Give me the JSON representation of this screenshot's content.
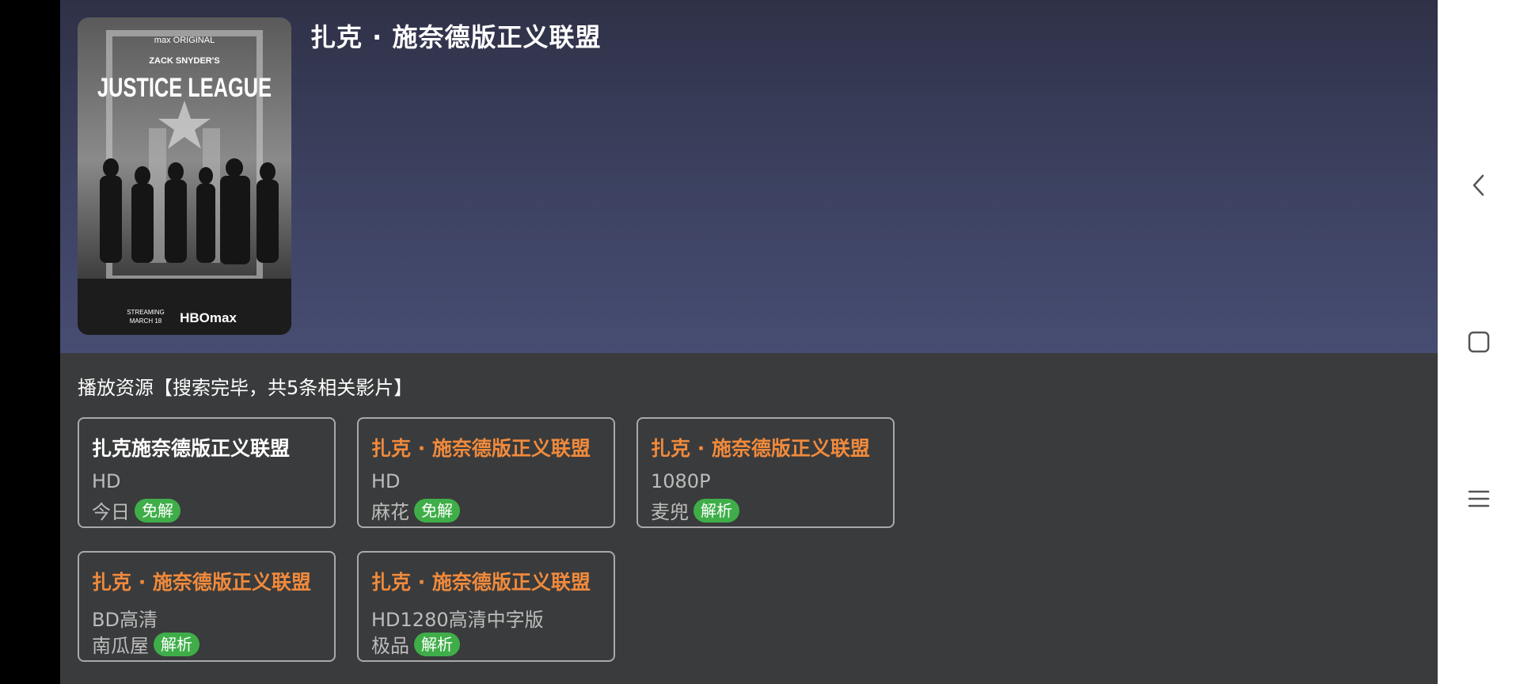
{
  "movie": {
    "title": "扎克 · 施奈德版正义联盟",
    "poster": {
      "brand": "max ORIGINAL",
      "tagline": "ZACK SNYDER'S",
      "headline": "JUSTICE LEAGUE",
      "footer_left_1": "STREAMING",
      "footer_left_2": "MARCH 18",
      "footer_brand": "HBOmax"
    }
  },
  "sources_section": {
    "title": "播放资源【搜索完毕，共5条相关影片】"
  },
  "sources": [
    {
      "title": "扎克施奈德版正义联盟",
      "quality": "HD",
      "provider": "今日",
      "badge": "免解",
      "selected": true
    },
    {
      "title": "扎克 · 施奈德版正义联盟",
      "quality": "HD",
      "provider": "麻花",
      "badge": "免解",
      "selected": false
    },
    {
      "title": "扎克 · 施奈德版正义联盟",
      "quality": "1080P",
      "provider": "麦兜",
      "badge": "解析",
      "selected": false
    },
    {
      "title": "扎克 · 施奈德版正义联盟",
      "quality": "BD高清",
      "provider": "南瓜屋",
      "badge": "解析",
      "selected": false
    },
    {
      "title": "扎克 · 施奈德版正义联盟",
      "quality": "HD1280高清中字版",
      "provider": "极品",
      "badge": "解析",
      "selected": false
    }
  ],
  "colors": {
    "selected_title": "#ffffff",
    "unselected_title": "#f08a3c",
    "badge_bg": "#3fae49"
  },
  "system_nav": {
    "back_icon": "back-chevron-icon",
    "home_icon": "home-square-icon",
    "recents_icon": "menu-lines-icon"
  }
}
